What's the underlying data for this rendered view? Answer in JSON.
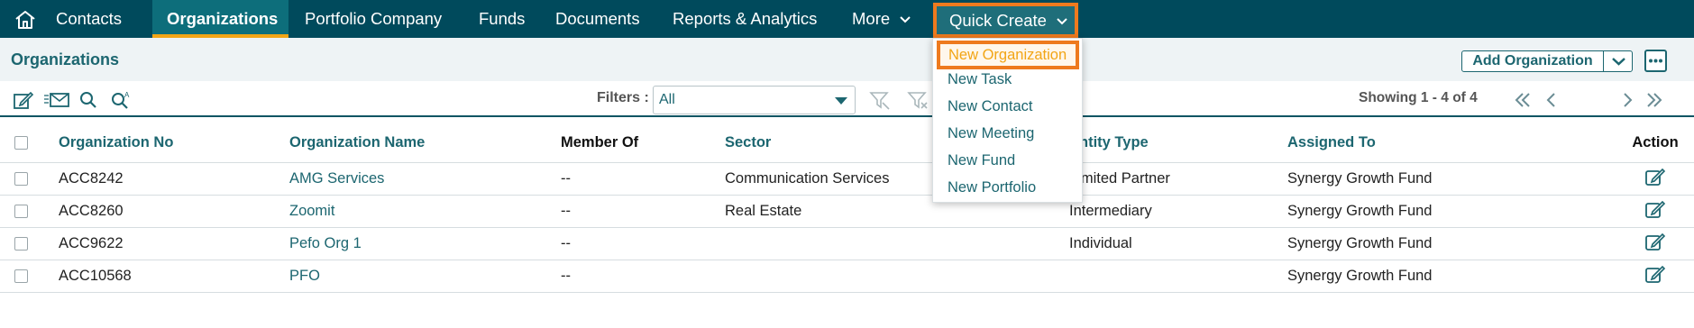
{
  "topnav": {
    "items": [
      {
        "label": "Contacts"
      },
      {
        "label": "Organizations",
        "active": true
      },
      {
        "label": "Portfolio Company"
      },
      {
        "label": "Funds"
      },
      {
        "label": "Documents"
      },
      {
        "label": "Reports & Analytics"
      },
      {
        "label": "More"
      }
    ],
    "quick_create": "Quick Create"
  },
  "page": {
    "title": "Organizations",
    "add_button": "Add Organization"
  },
  "toolbar": {
    "filters_label": "Filters :",
    "filters_value": "All",
    "showing": "Showing 1 - 4 of 4"
  },
  "table": {
    "headers": [
      "Organization No",
      "Organization Name",
      "Member Of",
      "Sector",
      "Entity Type",
      "Assigned To",
      "Action"
    ],
    "rows": [
      {
        "no": "ACC8242",
        "name": "AMG Services",
        "member_of": "--",
        "sector": "Communication Services",
        "entity_type": "Limited Partner",
        "assigned_to": "Synergy Growth Fund"
      },
      {
        "no": "ACC8260",
        "name": "Zoomit",
        "member_of": "--",
        "sector": "Real Estate",
        "entity_type": "Intermediary",
        "assigned_to": "Synergy Growth Fund"
      },
      {
        "no": "ACC9622",
        "name": "Pefo Org 1",
        "member_of": "--",
        "sector": "",
        "entity_type": "Individual",
        "assigned_to": "Synergy Growth Fund"
      },
      {
        "no": "ACC10568",
        "name": "PFO",
        "member_of": "--",
        "sector": "",
        "entity_type": "",
        "assigned_to": "Synergy Growth Fund"
      }
    ]
  },
  "quick_create_menu": {
    "items": [
      "New Organization",
      "New Task",
      "New Contact",
      "New Meeting",
      "New Fund",
      "New Portfolio"
    ],
    "highlighted": "New Organization"
  },
  "colors": {
    "nav_bg": "#004a5c",
    "accent": "#1c6670",
    "highlight": "#ee7a1e",
    "active_underline": "#f2a516"
  },
  "icons": [
    "home-icon",
    "chevron-down-icon",
    "edit-icon",
    "email-icon",
    "search-icon",
    "advanced-search-icon",
    "filter-icon",
    "clear-filter-icon",
    "first-page-icon",
    "previous-page-icon",
    "next-page-icon",
    "last-page-icon",
    "more-options-icon"
  ]
}
